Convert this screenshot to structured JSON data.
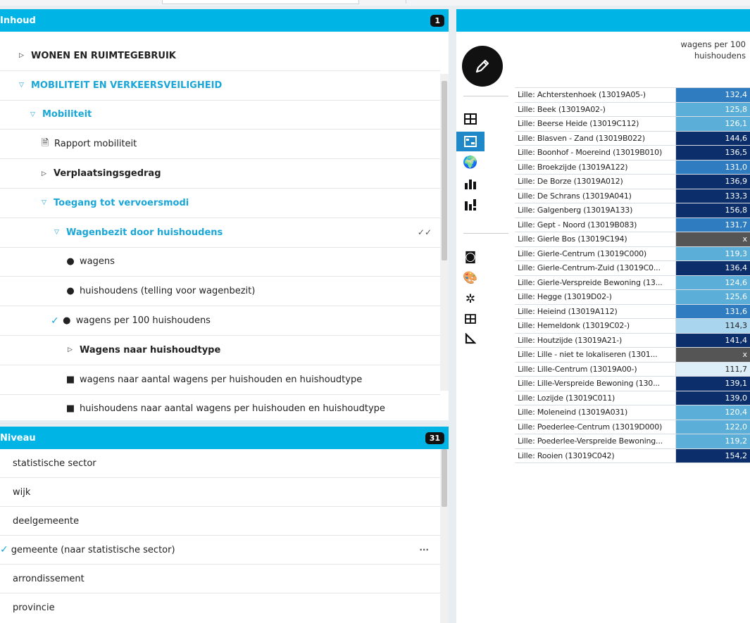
{
  "inhoud": {
    "title": "Inhoud",
    "badge": "1",
    "rows": [
      {
        "label": "WONEN EN RUIMTEGEBRUIK"
      },
      {
        "label": "MOBILITEIT EN VERKEERSVEILIGHEID"
      },
      {
        "label": "Mobiliteit"
      },
      {
        "label": "Rapport mobiliteit"
      },
      {
        "label": "Verplaatsingsgedrag"
      },
      {
        "label": "Toegang tot vervoersmodi"
      },
      {
        "label": "Wagenbezit door huishoudens",
        "mark": "✓✓"
      },
      {
        "label": "wagens"
      },
      {
        "label": "huishoudens (telling voor wagenbezit)"
      },
      {
        "label": "wagens per 100 huishoudens"
      },
      {
        "label": "Wagens naar huishoudtype"
      },
      {
        "label": "wagens naar aantal wagens per huishouden en huishoudtype"
      },
      {
        "label": "huishoudens naar aantal wagens per huishouden en huishoudtype"
      }
    ]
  },
  "niveau": {
    "title": "Niveau",
    "badge": "31",
    "rows": [
      {
        "label": "statistische sector"
      },
      {
        "label": "wijk"
      },
      {
        "label": "deelgemeente"
      },
      {
        "label": "gemeente (naar statistische sector)",
        "mark": "···"
      },
      {
        "label": "arrondissement"
      },
      {
        "label": "provincie"
      }
    ]
  },
  "table": {
    "column_header_line1": "wagens per 100",
    "column_header_line2": "huishoudens",
    "rows": [
      {
        "name": "Lille: Achterstenhoek (13019A05-)",
        "value": "132,4",
        "color": "#2f7cc0"
      },
      {
        "name": "Lille: Beek (13019A02-)",
        "value": "125,8",
        "color": "#5aaed8"
      },
      {
        "name": "Lille: Beerse Heide (13019C112)",
        "value": "126,1",
        "color": "#5aaed8"
      },
      {
        "name": "Lille: Blasven - Zand (13019B022)",
        "value": "144,6",
        "color": "#0c2f6b"
      },
      {
        "name": "Lille: Boonhof - Moereind (13019B010)",
        "value": "136,5",
        "color": "#0c2f6b"
      },
      {
        "name": "Lille: Broekzijde (13019A122)",
        "value": "131,0",
        "color": "#2f7cc0"
      },
      {
        "name": "Lille: De Borze (13019A012)",
        "value": "136,9",
        "color": "#0c2f6b"
      },
      {
        "name": "Lille: De Schrans (13019A041)",
        "value": "133,3",
        "color": "#0c2f6b"
      },
      {
        "name": "Lille: Galgenberg (13019A133)",
        "value": "156,8",
        "color": "#0c2f6b"
      },
      {
        "name": "Lille: Gept - Noord (13019B083)",
        "value": "131,7",
        "color": "#2f7cc0"
      },
      {
        "name": "Lille: Gierle Bos (13019C194)",
        "value": "x",
        "color": "#555555"
      },
      {
        "name": "Lille: Gierle-Centrum (13019C000)",
        "value": "119,3",
        "color": "#5aaed8"
      },
      {
        "name": "Lille: Gierle-Centrum-Zuid (13019C0...",
        "value": "136,4",
        "color": "#0c2f6b"
      },
      {
        "name": "Lille: Gierle-Verspreide Bewoning (13...",
        "value": "124,6",
        "color": "#5aaed8"
      },
      {
        "name": "Lille: Hegge (13019D02-)",
        "value": "125,6",
        "color": "#5aaed8"
      },
      {
        "name": "Lille: Heieind (13019A112)",
        "value": "131,6",
        "color": "#2f7cc0"
      },
      {
        "name": "Lille: Hemeldonk (13019C02-)",
        "value": "114,3",
        "color": "#a9d6ee"
      },
      {
        "name": "Lille: Houtzijde (13019A21-)",
        "value": "141,4",
        "color": "#0c2f6b"
      },
      {
        "name": "Lille: Lille - niet te lokaliseren (1301...",
        "value": "x",
        "color": "#555555"
      },
      {
        "name": "Lille: Lille-Centrum (13019A00-)",
        "value": "111,7",
        "color": "#deeef9"
      },
      {
        "name": "Lille: Lille-Verspreide Bewoning (130...",
        "value": "139,1",
        "color": "#0c2f6b"
      },
      {
        "name": "Lille: Lozijde (13019C011)",
        "value": "139,0",
        "color": "#0c2f6b"
      },
      {
        "name": "Lille: Moleneind (13019A031)",
        "value": "120,4",
        "color": "#5aaed8"
      },
      {
        "name": "Lille: Poederlee-Centrum (13019D000)",
        "value": "122,0",
        "color": "#5aaed8"
      },
      {
        "name": "Lille: Poederlee-Verspreide Bewoning...",
        "value": "119,2",
        "color": "#5aaed8"
      },
      {
        "name": "Lille: Rooien (13019C042)",
        "value": "154,2",
        "color": "#0c2f6b"
      }
    ]
  }
}
